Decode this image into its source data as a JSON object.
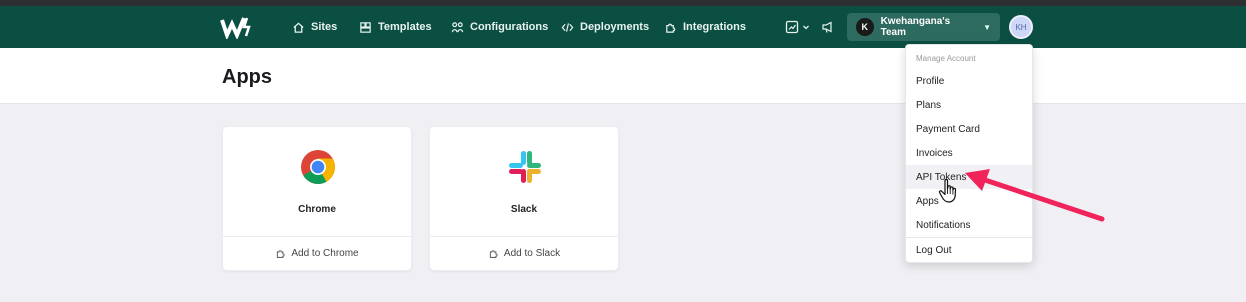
{
  "nav": {
    "items": [
      {
        "label": "Sites",
        "icon": "home-icon"
      },
      {
        "label": "Templates",
        "icon": "templates-icon"
      },
      {
        "label": "Configurations",
        "icon": "configurations-icon"
      },
      {
        "label": "Deployments",
        "icon": "code-icon"
      },
      {
        "label": "Integrations",
        "icon": "puzzle-icon"
      }
    ],
    "team_initial": "K",
    "team_name": "Kwehangana's Team",
    "user_initials": "KH"
  },
  "page": {
    "title": "Apps"
  },
  "apps": [
    {
      "name": "Chrome",
      "action": "Add to Chrome",
      "icon": "chrome-icon"
    },
    {
      "name": "Slack",
      "action": "Add to Slack",
      "icon": "slack-icon"
    }
  ],
  "dropdown": {
    "section_label": "Manage Account",
    "items": [
      "Profile",
      "Plans",
      "Payment Card",
      "Invoices",
      "API Tokens",
      "Apps",
      "Notifications"
    ],
    "logout": "Log Out",
    "highlighted": "API Tokens"
  },
  "colors": {
    "navbar": "#0b4f43",
    "annotation_arrow": "#f0245a"
  }
}
